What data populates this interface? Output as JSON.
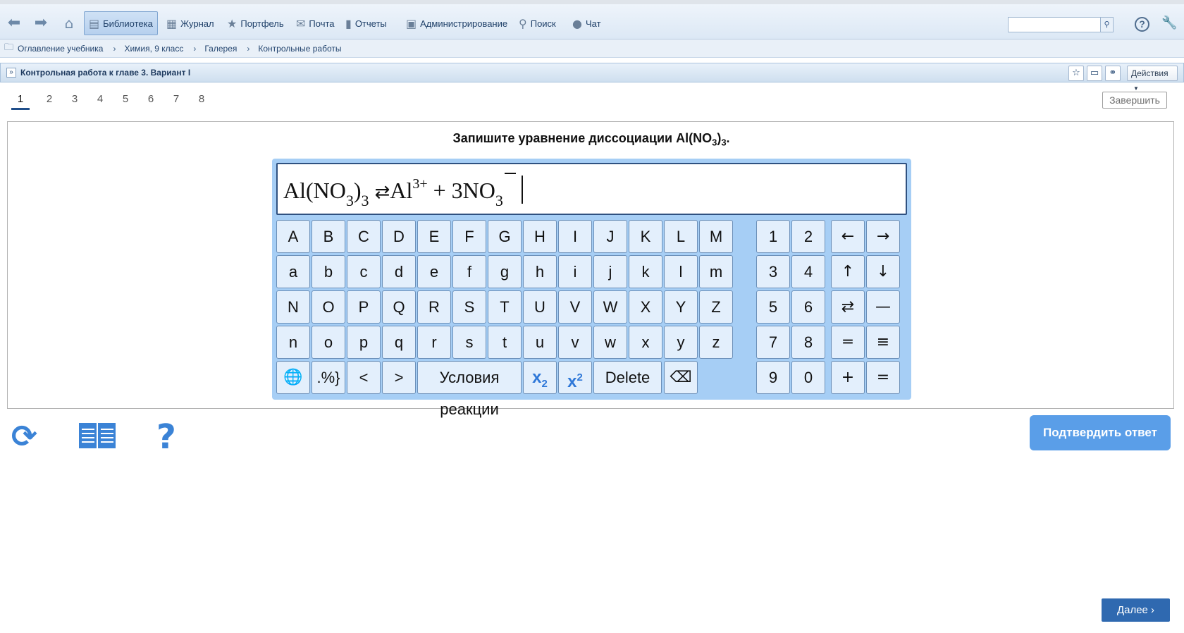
{
  "toolbar": {
    "items": [
      {
        "label": "Библиотека",
        "icon": "book-icon",
        "active": true
      },
      {
        "label": "Журнал",
        "icon": "journal-icon"
      },
      {
        "label": "Портфель",
        "icon": "star-icon"
      },
      {
        "label": "Почта",
        "icon": "mail-icon"
      },
      {
        "label": "Отчеты",
        "icon": "bar-chart-icon"
      },
      {
        "label": "Администрирование",
        "icon": "admin-icon"
      },
      {
        "label": "Поиск",
        "icon": "magnifier-icon"
      },
      {
        "label": "Чат",
        "icon": "chat-icon"
      }
    ],
    "search_value": ""
  },
  "breadcrumb": [
    "Оглавление учебника",
    "Химия, 9 класс",
    "Галерея",
    "Контрольные работы"
  ],
  "title": "Контрольная работа к главе 3. Вариант I",
  "actions_label": "Действия",
  "question_tabs": [
    "1",
    "2",
    "3",
    "4",
    "5",
    "6",
    "7",
    "8"
  ],
  "finish_label": "Завершить",
  "question": {
    "text_before": "Запишите уравнение диссоциации Al(NO",
    "sub1": "3",
    "text_mid": ")",
    "sub2": "3",
    "text_after": "."
  },
  "formula": {
    "p1": "Al(NO",
    "s1": "3",
    "p2": ")",
    "s2": "3",
    "arrow": "⇄",
    "p3": "Al",
    "sup1": "3+",
    "p4": " + 3NO",
    "s3": "3"
  },
  "keyboard": {
    "row1": [
      "A",
      "B",
      "C",
      "D",
      "E",
      "F",
      "G",
      "H",
      "I",
      "J",
      "K",
      "L",
      "M"
    ],
    "row2": [
      "a",
      "b",
      "c",
      "d",
      "e",
      "f",
      "g",
      "h",
      "i",
      "j",
      "k",
      "l",
      "m"
    ],
    "row3": [
      "N",
      "O",
      "P",
      "Q",
      "R",
      "S",
      "T",
      "U",
      "V",
      "W",
      "X",
      "Y",
      "Z"
    ],
    "row4": [
      "n",
      "o",
      "p",
      "q",
      "r",
      "s",
      "t",
      "u",
      "v",
      "w",
      "x",
      "y",
      "z"
    ],
    "row5": {
      "percent": ".%}",
      "lt": "<",
      "gt": ">",
      "conditions": "Условия реакции",
      "sub_x": "x",
      "sub_2": "2",
      "sup_x": "x",
      "sup_2": "2",
      "delete": "Delete"
    },
    "numpad": [
      [
        "1",
        "2"
      ],
      [
        "3",
        "4"
      ],
      [
        "5",
        "6"
      ],
      [
        "7",
        "8"
      ],
      [
        "9",
        "0"
      ]
    ],
    "symbols": [
      [
        "←",
        "→"
      ],
      [
        "↑",
        "↓"
      ],
      [
        "⇄",
        "—"
      ],
      [
        "═",
        "≡"
      ],
      [
        "+",
        "="
      ]
    ]
  },
  "confirm_label": "Подтвердить ответ",
  "next_label": "Далее ›"
}
